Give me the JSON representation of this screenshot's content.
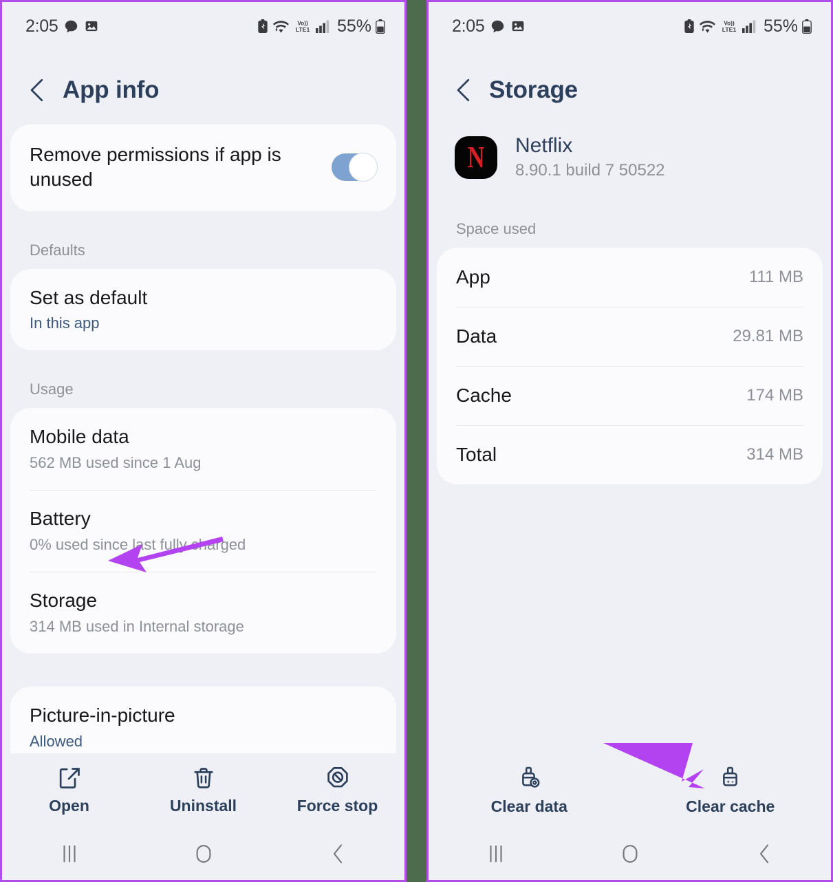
{
  "status_bar": {
    "time": "2:05",
    "left_icons": [
      "chat-bubble-icon",
      "gallery-icon"
    ],
    "right_icons": [
      "battery-saver-icon",
      "wifi-icon",
      "volte-lte1-icon",
      "signal-bars-icon"
    ],
    "network_label": "VoLTE LTE1",
    "battery_percent": "55%"
  },
  "left_panel": {
    "header": {
      "title": "App info",
      "back_icon": "back-chevron-icon"
    },
    "permissions_row": {
      "title": "Remove permissions if app is unused",
      "toggle_state": "on"
    },
    "defaults": {
      "label": "Defaults",
      "items": [
        {
          "title": "Set as default",
          "subtitle": "In this app"
        }
      ]
    },
    "usage": {
      "label": "Usage",
      "items": [
        {
          "title": "Mobile data",
          "subtitle": "562 MB used since 1 Aug"
        },
        {
          "title": "Battery",
          "subtitle": "0% used since last fully charged"
        },
        {
          "title": "Storage",
          "subtitle": "314 MB used in Internal storage"
        }
      ]
    },
    "pip": {
      "title": "Picture-in-picture",
      "subtitle": "Allowed"
    },
    "actions": [
      {
        "label": "Open",
        "icon": "external-link-icon"
      },
      {
        "label": "Uninstall",
        "icon": "trash-icon"
      },
      {
        "label": "Force stop",
        "icon": "stop-octagon-icon"
      }
    ]
  },
  "right_panel": {
    "header": {
      "title": "Storage",
      "back_icon": "back-chevron-icon"
    },
    "app": {
      "name": "Netflix",
      "version": "8.90.1 build 7 50522",
      "icon_letter": "N"
    },
    "space_used": {
      "label": "Space used",
      "rows": [
        {
          "key": "App",
          "value": "111 MB"
        },
        {
          "key": "Data",
          "value": "29.81 MB"
        },
        {
          "key": "Cache",
          "value": "174 MB"
        },
        {
          "key": "Total",
          "value": "314 MB"
        }
      ]
    },
    "actions": [
      {
        "label": "Clear data",
        "icon": "brush-clear-data-icon"
      },
      {
        "label": "Clear cache",
        "icon": "brush-clear-cache-icon"
      }
    ]
  },
  "nav_bar": {
    "buttons": [
      {
        "name": "recents-button",
        "icon": "recents-icon"
      },
      {
        "name": "home-button",
        "icon": "home-circle-icon"
      },
      {
        "name": "back-button",
        "icon": "back-chevron-icon"
      }
    ]
  },
  "annotations": {
    "arrow_color": "#b342f0",
    "arrows": [
      {
        "name": "arrow-pointing-to-storage",
        "target": "Storage"
      },
      {
        "name": "arrow-pointing-to-clear-cache",
        "target": "Clear cache"
      }
    ]
  },
  "colors": {
    "background": "#eff0f5",
    "card": "#fbfbfd",
    "title": "#2c405c",
    "muted": "#8e9097",
    "accent_purple": "#b342f0",
    "divider_green": "#4d6b4d",
    "toggle_on": "#7ea3d0",
    "netflix_red": "#d81f26"
  }
}
